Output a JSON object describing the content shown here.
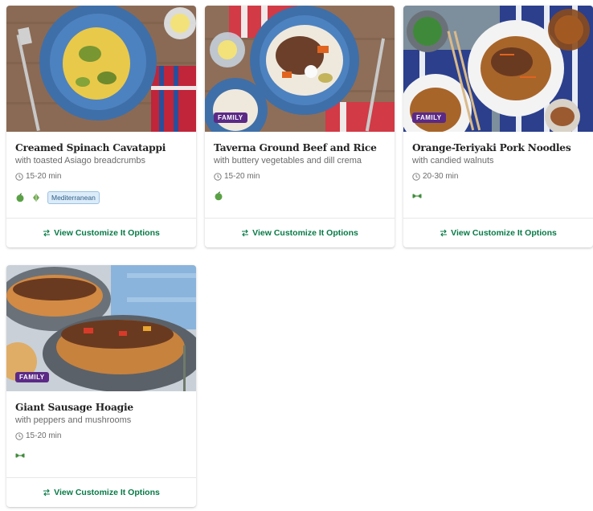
{
  "recipes": [
    {
      "title": "Creamed Spinach Cavatappi",
      "subtitle": "with toasted Asiago breadcrumbs",
      "time": "15-20 min",
      "badge": "",
      "cuisine": "Mediterranean",
      "tag_icons": [
        "apple-icon",
        "leaf-icon"
      ],
      "cta": "View Customize It Options"
    },
    {
      "title": "Taverna Ground Beef and Rice",
      "subtitle": "with buttery vegetables and dill crema",
      "time": "15-20 min",
      "badge": "FAMILY",
      "cuisine": "",
      "tag_icons": [
        "apple-icon"
      ],
      "cta": "View Customize It Options"
    },
    {
      "title": "Orange-Teriyaki Pork Noodles",
      "subtitle": "with candied walnuts",
      "time": "20-30 min",
      "badge": "FAMILY",
      "cuisine": "",
      "tag_icons": [
        "dumbbell-icon"
      ],
      "cta": "View Customize It Options"
    },
    {
      "title": "Giant Sausage Hoagie",
      "subtitle": "with peppers and mushrooms",
      "time": "15-20 min",
      "badge": "FAMILY",
      "cuisine": "",
      "tag_icons": [
        "dumbbell-icon"
      ],
      "cta": "View Customize It Options"
    }
  ],
  "colors": {
    "accent_green": "#067a46",
    "family_badge": "#5b2a86",
    "cuisine_tag_bg": "#dcecf8"
  }
}
